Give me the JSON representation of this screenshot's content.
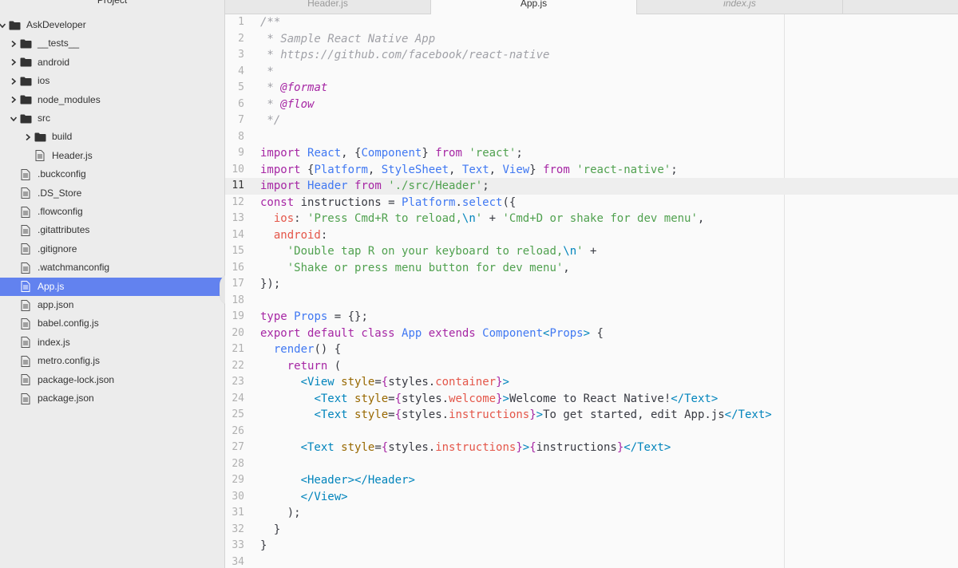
{
  "sidebar": {
    "title": "Project",
    "items": [
      {
        "label": "AskDeveloper",
        "type": "folder",
        "depth": 0,
        "expanded": true,
        "icon": "folder-icon"
      },
      {
        "label": "__tests__",
        "type": "folder",
        "depth": 1,
        "expanded": false,
        "icon": "folder-icon"
      },
      {
        "label": "android",
        "type": "folder",
        "depth": 1,
        "expanded": false,
        "icon": "folder-icon"
      },
      {
        "label": "ios",
        "type": "folder",
        "depth": 1,
        "expanded": false,
        "icon": "folder-icon"
      },
      {
        "label": "node_modules",
        "type": "folder",
        "depth": 1,
        "expanded": false,
        "icon": "folder-icon"
      },
      {
        "label": "src",
        "type": "folder",
        "depth": 1,
        "expanded": true,
        "icon": "folder-icon"
      },
      {
        "label": "build",
        "type": "folder",
        "depth": 2,
        "expanded": false,
        "icon": "folder-icon"
      },
      {
        "label": "Header.js",
        "type": "file",
        "depth": 2,
        "icon": "file-icon"
      },
      {
        "label": ".buckconfig",
        "type": "file",
        "depth": 1,
        "icon": "file-icon"
      },
      {
        "label": ".DS_Store",
        "type": "file",
        "depth": 1,
        "icon": "file-icon"
      },
      {
        "label": ".flowconfig",
        "type": "file",
        "depth": 1,
        "icon": "file-icon"
      },
      {
        "label": ".gitattributes",
        "type": "file",
        "depth": 1,
        "icon": "file-icon"
      },
      {
        "label": ".gitignore",
        "type": "file",
        "depth": 1,
        "icon": "file-icon"
      },
      {
        "label": ".watchmanconfig",
        "type": "file",
        "depth": 1,
        "icon": "file-icon"
      },
      {
        "label": "App.js",
        "type": "file",
        "depth": 1,
        "icon": "file-icon",
        "selected": true
      },
      {
        "label": "app.json",
        "type": "file",
        "depth": 1,
        "icon": "file-icon"
      },
      {
        "label": "babel.config.js",
        "type": "file",
        "depth": 1,
        "icon": "file-icon"
      },
      {
        "label": "index.js",
        "type": "file",
        "depth": 1,
        "icon": "file-icon"
      },
      {
        "label": "metro.config.js",
        "type": "file",
        "depth": 1,
        "icon": "file-icon"
      },
      {
        "label": "package-lock.json",
        "type": "file",
        "depth": 1,
        "icon": "file-icon"
      },
      {
        "label": "package.json",
        "type": "file",
        "depth": 1,
        "icon": "file-icon"
      }
    ],
    "collapse_icon": "chevron-left-icon"
  },
  "tabs": [
    {
      "label": "Header.js",
      "active": false,
      "italic": false
    },
    {
      "label": "App.js",
      "active": true,
      "italic": false
    },
    {
      "label": "index.js",
      "active": false,
      "italic": true
    }
  ],
  "editor": {
    "cursor_line": 11,
    "lines": [
      {
        "n": "1",
        "t": [
          [
            "cm",
            "/**"
          ]
        ]
      },
      {
        "n": "2",
        "t": [
          [
            "cm",
            " * Sample React Native App"
          ]
        ]
      },
      {
        "n": "3",
        "t": [
          [
            "cm",
            " * https://github.com/facebook/react-native"
          ]
        ]
      },
      {
        "n": "4",
        "t": [
          [
            "cm",
            " *"
          ]
        ]
      },
      {
        "n": "5",
        "t": [
          [
            "cm",
            " * "
          ],
          [
            "tag",
            "@format"
          ]
        ]
      },
      {
        "n": "6",
        "t": [
          [
            "cm",
            " * "
          ],
          [
            "tag",
            "@flow"
          ]
        ]
      },
      {
        "n": "7",
        "t": [
          [
            "cm",
            " */"
          ]
        ]
      },
      {
        "n": "8",
        "t": []
      },
      {
        "n": "9",
        "t": [
          [
            "kw",
            "import "
          ],
          [
            "cls",
            "React"
          ],
          [
            "pl",
            ", {"
          ],
          [
            "cls",
            "Component"
          ],
          [
            "pl",
            "} "
          ],
          [
            "kw",
            "from "
          ],
          [
            "str",
            "'react'"
          ],
          [
            "pl",
            ";"
          ]
        ]
      },
      {
        "n": "10",
        "t": [
          [
            "kw",
            "import "
          ],
          [
            "pl",
            "{"
          ],
          [
            "cls",
            "Platform"
          ],
          [
            "pl",
            ", "
          ],
          [
            "cls",
            "StyleSheet"
          ],
          [
            "pl",
            ", "
          ],
          [
            "cls",
            "Text"
          ],
          [
            "pl",
            ", "
          ],
          [
            "cls",
            "View"
          ],
          [
            "pl",
            "} "
          ],
          [
            "kw",
            "from "
          ],
          [
            "str",
            "'react-native'"
          ],
          [
            "pl",
            ";"
          ]
        ]
      },
      {
        "n": "11",
        "t": [
          [
            "kw",
            "import "
          ],
          [
            "cls",
            "Header "
          ],
          [
            "kw",
            "from "
          ],
          [
            "str",
            "'./src/Header'"
          ],
          [
            "pl",
            ";"
          ]
        ]
      },
      {
        "n": "12",
        "t": [
          [
            "kw",
            "const "
          ],
          [
            "pl",
            "instructions = "
          ],
          [
            "cls",
            "Platform"
          ],
          [
            "pl",
            "."
          ],
          [
            "fn",
            "select"
          ],
          [
            "pl",
            "({"
          ]
        ]
      },
      {
        "n": "13",
        "t": [
          [
            "pl",
            "  "
          ],
          [
            "prop",
            "ios"
          ],
          [
            "pl",
            ": "
          ],
          [
            "str",
            "'Press Cmd+R to reload,"
          ],
          [
            "esc",
            "\\n"
          ],
          [
            "str",
            "'"
          ],
          [
            "pl",
            " + "
          ],
          [
            "str",
            "'Cmd+D or shake for dev menu'"
          ],
          [
            "pl",
            ","
          ]
        ]
      },
      {
        "n": "14",
        "t": [
          [
            "pl",
            "  "
          ],
          [
            "prop",
            "android"
          ],
          [
            "pl",
            ":"
          ]
        ]
      },
      {
        "n": "15",
        "t": [
          [
            "pl",
            "    "
          ],
          [
            "str",
            "'Double tap R on your keyboard to reload,"
          ],
          [
            "esc",
            "\\n"
          ],
          [
            "str",
            "'"
          ],
          [
            "pl",
            " +"
          ]
        ]
      },
      {
        "n": "16",
        "t": [
          [
            "pl",
            "    "
          ],
          [
            "str",
            "'Shake or press menu button for dev menu'"
          ],
          [
            "pl",
            ","
          ]
        ]
      },
      {
        "n": "17",
        "t": [
          [
            "pl",
            "});"
          ]
        ]
      },
      {
        "n": "18",
        "t": []
      },
      {
        "n": "19",
        "t": [
          [
            "kw",
            "type "
          ],
          [
            "cls",
            "Props"
          ],
          [
            "pl",
            " = {};"
          ]
        ]
      },
      {
        "n": "20",
        "t": [
          [
            "kw",
            "export default class "
          ],
          [
            "cls",
            "App "
          ],
          [
            "kw",
            "extends "
          ],
          [
            "cls",
            "Component"
          ],
          [
            "jsx",
            "<"
          ],
          [
            "cls",
            "Props"
          ],
          [
            "jsx",
            ">"
          ],
          [
            "pl",
            " {"
          ]
        ]
      },
      {
        "n": "21",
        "t": [
          [
            "pl",
            "  "
          ],
          [
            "fn",
            "render"
          ],
          [
            "pl",
            "() {"
          ]
        ]
      },
      {
        "n": "22",
        "t": [
          [
            "pl",
            "    "
          ],
          [
            "kw",
            "return"
          ],
          [
            "pl",
            " ("
          ]
        ]
      },
      {
        "n": "23",
        "t": [
          [
            "pl",
            "      "
          ],
          [
            "jsx",
            "<View "
          ],
          [
            "attr",
            "style"
          ],
          [
            "pl",
            "="
          ],
          [
            "br",
            "{"
          ],
          [
            "pl",
            "styles."
          ],
          [
            "prop",
            "container"
          ],
          [
            "br",
            "}"
          ],
          [
            "jsx",
            ">"
          ]
        ]
      },
      {
        "n": "24",
        "t": [
          [
            "pl",
            "        "
          ],
          [
            "jsx",
            "<Text "
          ],
          [
            "attr",
            "style"
          ],
          [
            "pl",
            "="
          ],
          [
            "br",
            "{"
          ],
          [
            "pl",
            "styles."
          ],
          [
            "prop",
            "welcome"
          ],
          [
            "br",
            "}"
          ],
          [
            "jsx",
            ">"
          ],
          [
            "pl",
            "Welcome to React Native!"
          ],
          [
            "jsx",
            "</Text>"
          ]
        ]
      },
      {
        "n": "25",
        "t": [
          [
            "pl",
            "        "
          ],
          [
            "jsx",
            "<Text "
          ],
          [
            "attr",
            "style"
          ],
          [
            "pl",
            "="
          ],
          [
            "br",
            "{"
          ],
          [
            "pl",
            "styles."
          ],
          [
            "prop",
            "instructions"
          ],
          [
            "br",
            "}"
          ],
          [
            "jsx",
            ">"
          ],
          [
            "pl",
            "To get started, edit App.js"
          ],
          [
            "jsx",
            "</Text>"
          ]
        ]
      },
      {
        "n": "26",
        "t": []
      },
      {
        "n": "27",
        "t": [
          [
            "pl",
            "      "
          ],
          [
            "jsx",
            "<Text "
          ],
          [
            "attr",
            "style"
          ],
          [
            "pl",
            "="
          ],
          [
            "br",
            "{"
          ],
          [
            "pl",
            "styles."
          ],
          [
            "prop",
            "instructions"
          ],
          [
            "br",
            "}"
          ],
          [
            "jsx",
            ">"
          ],
          [
            "br",
            "{"
          ],
          [
            "pl",
            "instructions"
          ],
          [
            "br",
            "}"
          ],
          [
            "jsx",
            "</Text>"
          ]
        ]
      },
      {
        "n": "28",
        "t": []
      },
      {
        "n": "29",
        "t": [
          [
            "pl",
            "      "
          ],
          [
            "jsx",
            "<Header></Header>"
          ]
        ]
      },
      {
        "n": "30",
        "t": [
          [
            "pl",
            "      "
          ],
          [
            "jsx",
            "</View>"
          ]
        ]
      },
      {
        "n": "31",
        "t": [
          [
            "pl",
            "    );"
          ]
        ]
      },
      {
        "n": "32",
        "t": [
          [
            "pl",
            "  }"
          ]
        ]
      },
      {
        "n": "33",
        "t": [
          [
            "pl",
            "}"
          ]
        ]
      },
      {
        "n": "34",
        "t": []
      }
    ]
  },
  "colors": {
    "selection": "#6282ef",
    "sidebar_bg": "#ececec",
    "editor_bg": "#fafafa"
  }
}
